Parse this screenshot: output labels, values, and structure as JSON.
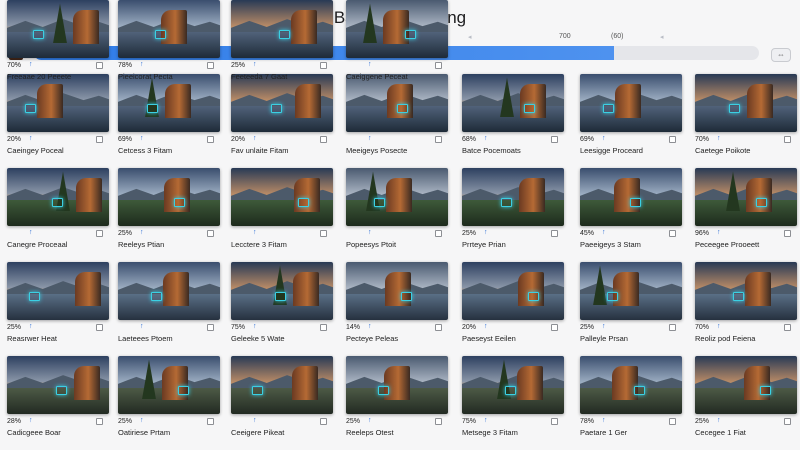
{
  "window": {
    "title": "Batch Processing"
  },
  "progress": {
    "percent": 80,
    "labels": [
      "70",
      "100",
      "700",
      "(60)"
    ],
    "fill_color": "#2f7ce8",
    "end_button_icon": "link-icon",
    "end_button_glyph": "⇔"
  },
  "grid": {
    "item_icon": "up-arrow-icon",
    "up_glyph": "↑",
    "items": [
      {
        "pct": "20%",
        "name": "Caeingey Poceal"
      },
      {
        "pct": "69%",
        "name": "Cetcess 3 Fitam"
      },
      {
        "pct": "20%",
        "name": "Fav unlaite Fitam"
      },
      {
        "pct": "",
        "name": "Meeigeys Posecte"
      },
      {
        "pct": "68%",
        "name": "Batce Pocemoats"
      },
      {
        "pct": "69%",
        "name": "Leesigge Proceard"
      },
      {
        "pct": "70%",
        "name": "Caetege Poikote"
      },
      {
        "pct": "",
        "name": "Canegre Proceaal"
      },
      {
        "pct": "25%",
        "name": "Reeleys Ptian"
      },
      {
        "pct": "",
        "name": "Lecctere 3 Fitam"
      },
      {
        "pct": "",
        "name": "Popeesys Ptoit"
      },
      {
        "pct": "25%",
        "name": "Prrteye Prian"
      },
      {
        "pct": "45%",
        "name": "Paeeigeys 3 Stam"
      },
      {
        "pct": "96%",
        "name": "Peceegee Prooeett"
      },
      {
        "pct": "25%",
        "name": "Reasrwer Heat"
      },
      {
        "pct": "",
        "name": "Laeteees Ptoem"
      },
      {
        "pct": "75%",
        "name": "Geleeke 5 Wate"
      },
      {
        "pct": "14%",
        "name": "Pecteye Peleas"
      },
      {
        "pct": "20%",
        "name": "Paeseyst Eeilen"
      },
      {
        "pct": "25%",
        "name": "Palleyle Prsan"
      },
      {
        "pct": "70%",
        "name": "Reoliz pod Feiena"
      },
      {
        "pct": "28%",
        "name": "Cadicgeee Boar"
      },
      {
        "pct": "25%",
        "name": "Oatiriese Prtam"
      },
      {
        "pct": "",
        "name": "Ceeigere Pikeat"
      },
      {
        "pct": "25%",
        "name": "Reeleps Otest"
      },
      {
        "pct": "75%",
        "name": "Metsege 3 Fitam"
      },
      {
        "pct": "78%",
        "name": "Paetare 1 Ger"
      },
      {
        "pct": "25%",
        "name": "Cecegee 1 Fiat"
      },
      {
        "pct": "70%",
        "name": "Freeaae 20 Peeete"
      },
      {
        "pct": "78%",
        "name": "Pieeicorat Pecta"
      },
      {
        "pct": "25%",
        "name": "Feeteeda 7 Gaat"
      },
      {
        "pct": "",
        "name": "Caeiggene Peceat"
      }
    ]
  }
}
